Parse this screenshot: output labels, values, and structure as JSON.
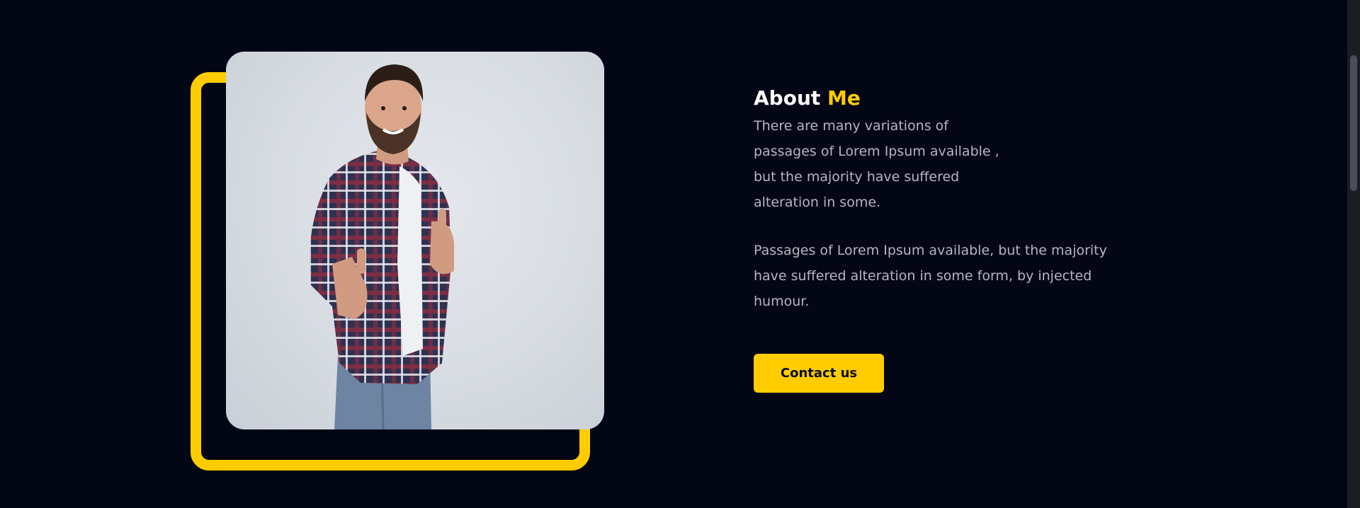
{
  "about": {
    "title_main": "About",
    "title_accent": "Me",
    "paragraph1": "There are many variations of passages of Lorem Ipsum available , but the majority have suffered alteration in some.",
    "paragraph2": "Passages of Lorem Ipsum available, but the majority have suffered alteration in some form, by injected humour.",
    "contact_label": "Contact us"
  },
  "colors": {
    "background": "#030615",
    "accent": "#ffcc00",
    "body_text": "#b4b7c2",
    "title_text": "#ffffff"
  },
  "icons": {
    "photo": "person-thumbs-up-photo"
  }
}
